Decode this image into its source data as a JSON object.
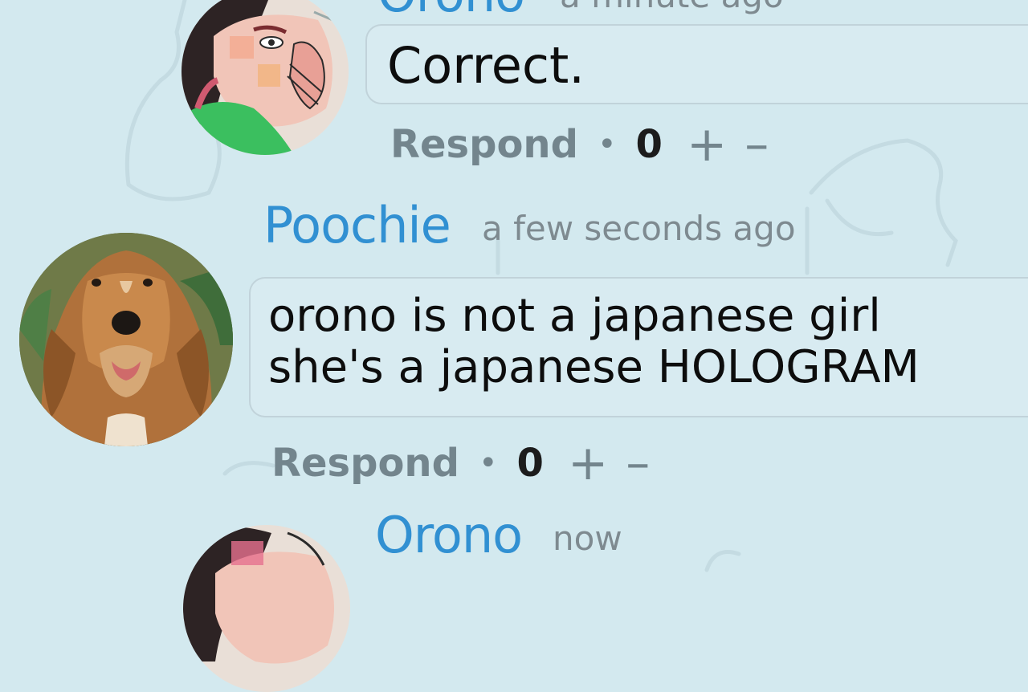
{
  "comments": [
    {
      "author": "Orono",
      "time": "a minute ago",
      "text": "Correct.",
      "respond_label": "Respond",
      "separator": "•",
      "score": "0",
      "upvote": "+",
      "downvote": "–"
    },
    {
      "author": "Poochie",
      "time": "a few seconds ago",
      "text_lines": [
        "orono is not a japanese girl",
        "she's a japanese HOLOGRAM"
      ],
      "respond_label": "Respond",
      "separator": "•",
      "score": "0",
      "upvote": "+",
      "downvote": "–"
    },
    {
      "author": "Orono",
      "time": "now"
    }
  ],
  "colors": {
    "background": "#d3e9ef",
    "author_link": "#3190d2",
    "timestamp": "#7e8a90",
    "action_text": "#73858d"
  },
  "icons": {
    "avatar_orono": "anime-girl-drawing-avatar",
    "avatar_poochie": "golden-retriever-photo-avatar"
  }
}
